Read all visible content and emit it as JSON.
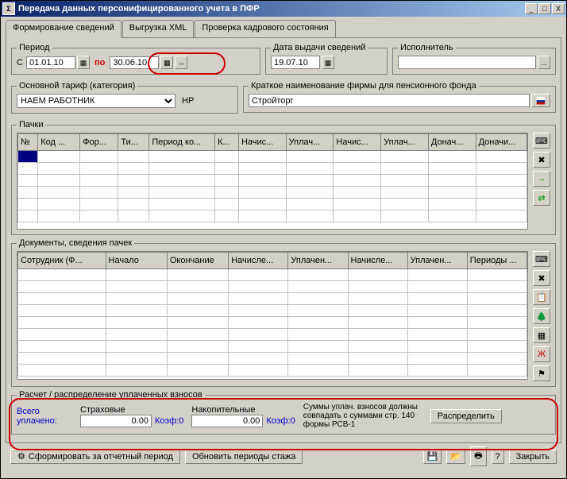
{
  "window": {
    "title": "Передача данных персонифицированного учета в ПФР"
  },
  "titlebar_buttons": {
    "min": "_",
    "max": "□",
    "close": "X"
  },
  "tabs": {
    "form": "Формирование сведений",
    "xml": "Выгрузка XML",
    "check": "Проверка кадрового состояния"
  },
  "period": {
    "legend": "Период",
    "from_label": "С",
    "from_value": "01.01.10",
    "to_label": "по",
    "to_value": "30.06.10"
  },
  "issue_date": {
    "legend": "Дата выдачи сведений",
    "value": "19.07.10"
  },
  "executor": {
    "legend": "Исполнитель",
    "value": ""
  },
  "tariff": {
    "legend": "Основной тариф (категория)",
    "value": "НАЕМ РАБОТНИК",
    "code": "НР"
  },
  "firm": {
    "legend": "Краткое наименование фирмы для пенсионного фонда",
    "value": "Стройторг",
    "flag_icon": "flag"
  },
  "packs": {
    "legend": "Пачки",
    "columns": [
      "№",
      "Код ...",
      "Фор...",
      "Ти...",
      "Период ко...",
      "К...",
      "Начис...",
      "Уплач...",
      "Начис...",
      "Уплач...",
      "Донач...",
      "Доначи..."
    ],
    "side_icons": [
      "keyboard",
      "table-x",
      "arrow-right",
      "arrow-swap"
    ]
  },
  "docs": {
    "legend": "Документы, сведения пачек",
    "columns": [
      "Сотрудник (Ф...",
      "Начало",
      "Окончание",
      "Начисле...",
      "Уплачен...",
      "Начисле...",
      "Уплачен...",
      "Периоды ..."
    ],
    "side_icons": [
      "keyboard",
      "table-x",
      "doc-list",
      "tree",
      "table-blue",
      "x-red",
      "spec"
    ]
  },
  "calc": {
    "legend": "Расчет / распределение уплаченных взносов",
    "total_label": "Всего уплачено:",
    "strah_label": "Страховые",
    "strah_value": "0.00",
    "strah_coef": "Коэф:0",
    "nakop_label": "Накопительные",
    "nakop_value": "0.00",
    "nakop_coef": "Коэф:0",
    "note": "Суммы уплач. взносов должны совпадать с суммами стр. 140 формы РСВ-1",
    "distribute": "Распределить"
  },
  "buttons": {
    "form_period": "Сформировать за отчетный период",
    "refresh_stazh": "Обновить периоды стажа",
    "close": "Закрыть"
  },
  "toolbar_icons": {
    "save": "💾",
    "open": "📂",
    "print": "🖶",
    "help": "?"
  }
}
